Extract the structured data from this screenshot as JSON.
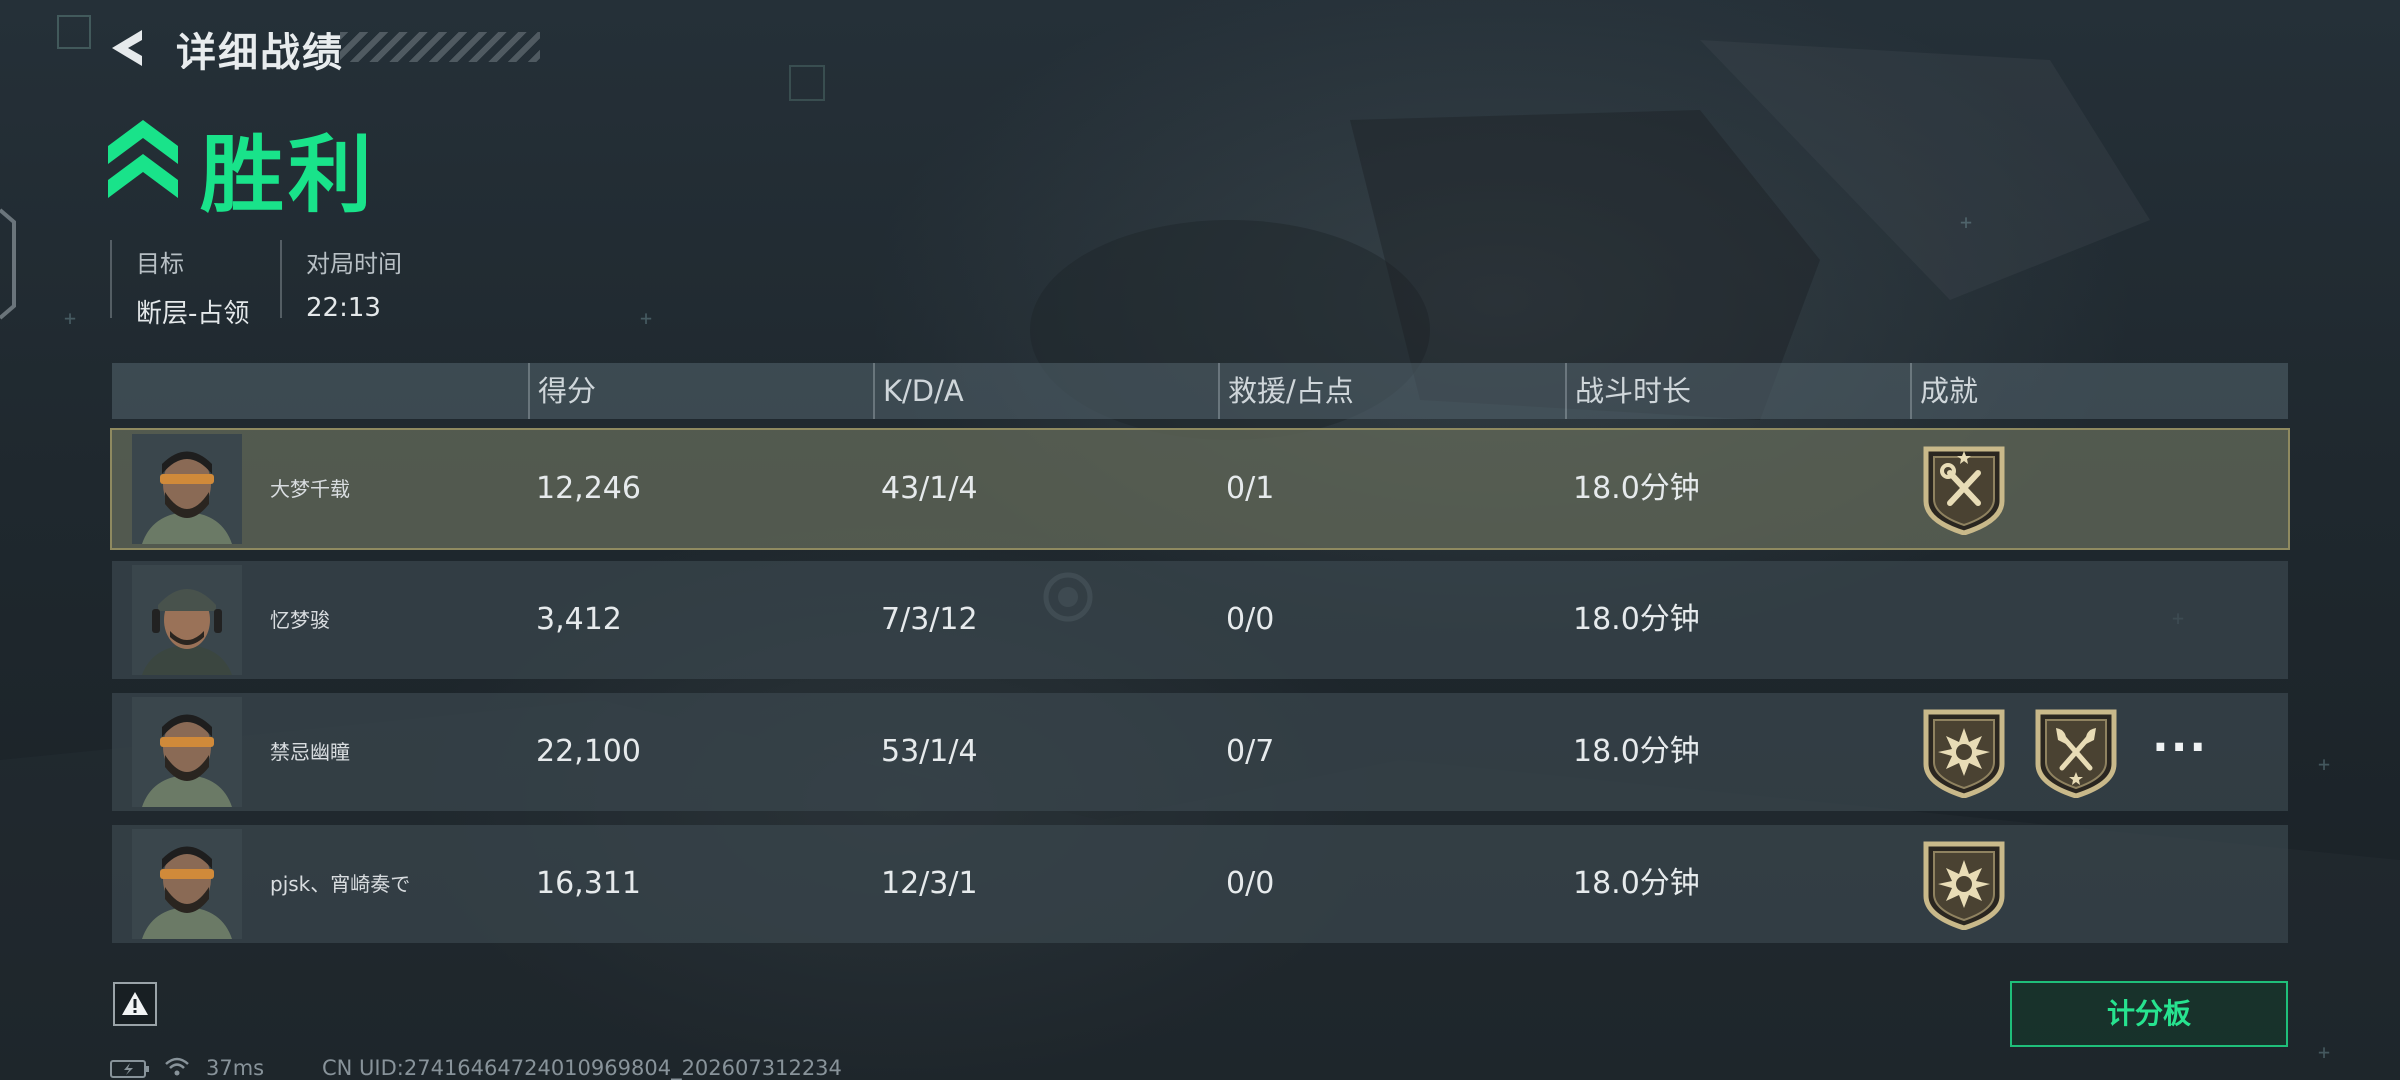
{
  "header": {
    "title": "详细战绩",
    "result": "胜利"
  },
  "match_info": {
    "objective_label": "目标",
    "objective_value": "断层-占领",
    "duration_label": "对局时间",
    "duration_value": "22:13"
  },
  "table": {
    "columns": [
      "",
      "得分",
      "K/D/A",
      "救援/占点",
      "战斗时长",
      "成就"
    ],
    "rows": [
      {
        "name": "大梦千载",
        "score": "12,246",
        "kda": "43/1/4",
        "rescue": "0/1",
        "time": "18.0分钟",
        "badges": [
          "wrench-badge-icon"
        ],
        "highlight": true
      },
      {
        "name": "忆梦骏",
        "score": "3,412",
        "kda": "7/3/12",
        "rescue": "0/0",
        "time": "18.0分钟",
        "badges": [],
        "highlight": false
      },
      {
        "name": "禁忌幽瞳",
        "score": "22,100",
        "kda": "53/1/4",
        "rescue": "0/7",
        "time": "18.0分钟",
        "badges": [
          "burst-badge-icon",
          "axe-badge-icon"
        ],
        "more": "···",
        "highlight": false
      },
      {
        "name": "pjsk、宵崎奏で",
        "score": "16,311",
        "kda": "12/3/1",
        "rescue": "0/0",
        "time": "18.0分钟",
        "badges": [
          "burst-badge-icon"
        ],
        "highlight": false
      }
    ]
  },
  "footer": {
    "scoreboard_label": "计分板",
    "ping": "37ms",
    "uid": "CN UID:2741646472401096​9804_202607312234"
  },
  "colors": {
    "accent": "#19e38a",
    "highlight_row": "#8f8a60",
    "badge_gold": "#c9b98a"
  }
}
